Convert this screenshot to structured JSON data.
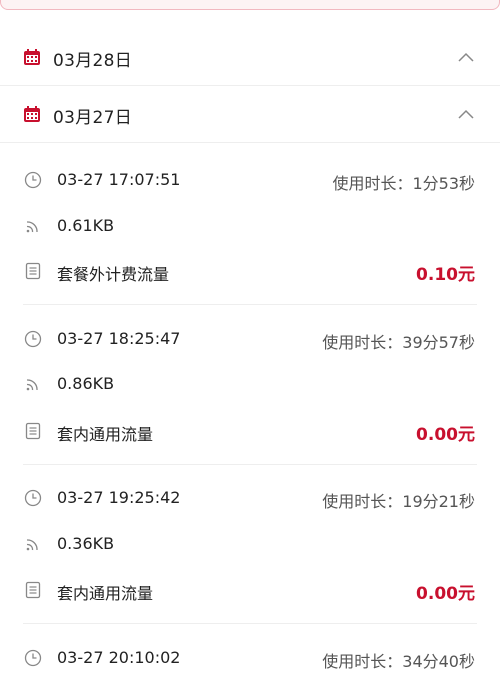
{
  "colors": {
    "accent": "#c8102e",
    "divider": "#eeeeee",
    "icon_gray": "#888888"
  },
  "days": [
    {
      "date": "03月28日",
      "icon": "calendar-icon",
      "toggle_icon": "chevron-up-icon"
    },
    {
      "date": "03月27日",
      "icon": "calendar-icon",
      "toggle_icon": "chevron-up-icon"
    }
  ],
  "duration_prefix": "使用时长：",
  "records": [
    {
      "time": "03-27 17:07:51",
      "duration": "使用时长：1分53秒",
      "traffic": "0.61KB",
      "plan": "套餐外计费流量",
      "fee": "0.10元"
    },
    {
      "time": "03-27 18:25:47",
      "duration": "使用时长：39分57秒",
      "traffic": "0.86KB",
      "plan": "套内通用流量",
      "fee": "0.00元"
    },
    {
      "time": "03-27 19:25:42",
      "duration": "使用时长：19分21秒",
      "traffic": "0.36KB",
      "plan": "套内通用流量",
      "fee": "0.00元"
    },
    {
      "time": "03-27 20:10:02",
      "duration": "使用时长：34分40秒"
    }
  ]
}
